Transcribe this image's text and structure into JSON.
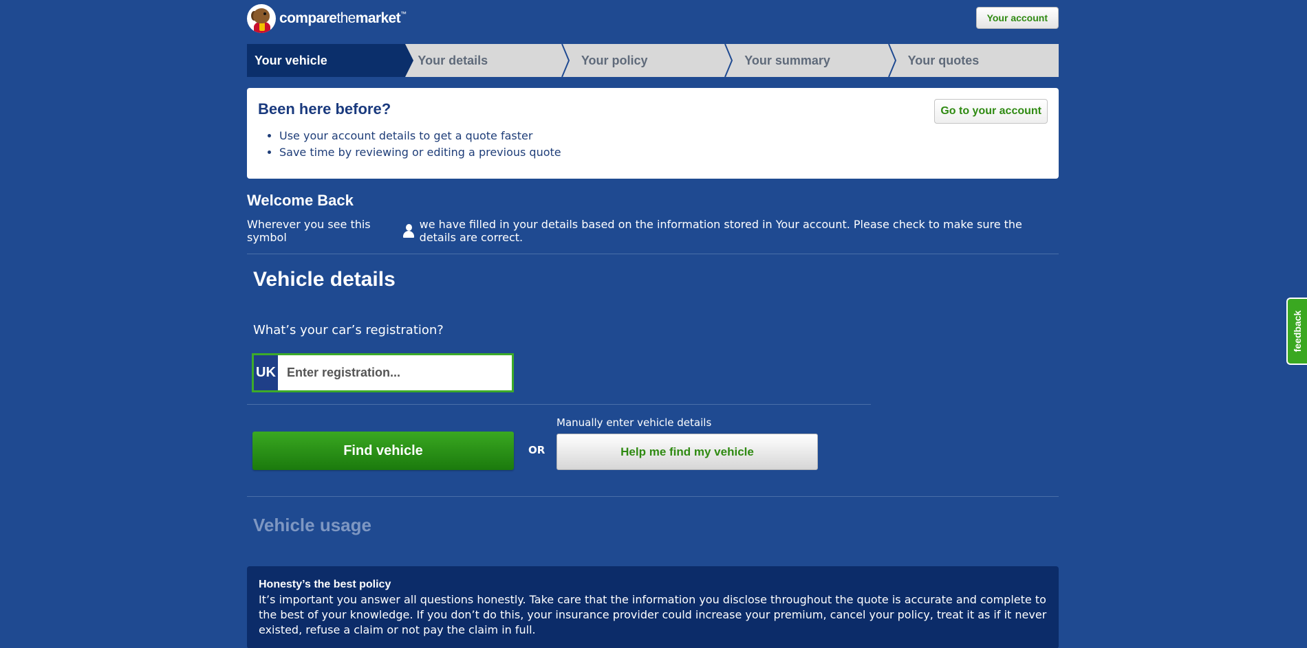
{
  "header": {
    "logo": {
      "bold1": "compare",
      "light": "the",
      "bold2": "market",
      "tm": "™"
    },
    "account_button": "Your account"
  },
  "steps": [
    {
      "label": "Your vehicle",
      "active": true
    },
    {
      "label": "Your details",
      "active": false
    },
    {
      "label": "Your policy",
      "active": false
    },
    {
      "label": "Your summary",
      "active": false
    },
    {
      "label": "Your quotes",
      "active": false
    }
  ],
  "panel": {
    "title": "Been here before?",
    "bullets": [
      "Use your account details to get a quote faster",
      "Save time by reviewing or editing a previous quote"
    ],
    "button": "Go to your account"
  },
  "welcome": {
    "title": "Welcome Back",
    "text_before": "Wherever you see this symbol",
    "text_after": "we have filled in your details based on the information stored in Your account. Please check to make sure the details are correct."
  },
  "vehicle": {
    "title": "Vehicle details",
    "question": "What’s your car’s registration?",
    "reg_prefix": "UK",
    "reg_placeholder": "Enter registration...",
    "find_button": "Find vehicle",
    "or": "OR",
    "manual_label": "Manually enter vehicle details",
    "help_button": "Help me find my vehicle"
  },
  "usage": {
    "title": "Vehicle usage"
  },
  "honesty": {
    "title": "Honesty’s the best policy",
    "text": "It’s important you answer all questions honestly. Take care that the information you disclose throughout the quote is accurate and complete to the best of your knowledge. If you don’t do this, your insurance provider could increase your premium, cancel your policy, treat it as if it never existed, refuse a claim or not pay the claim in full."
  },
  "feedback": {
    "label": "feedback"
  },
  "colors": {
    "page_bg": "#1f4a91",
    "accent_green": "#2f8a12",
    "active_step": "#0b2f6b",
    "honesty_bg": "#0c2c69"
  }
}
